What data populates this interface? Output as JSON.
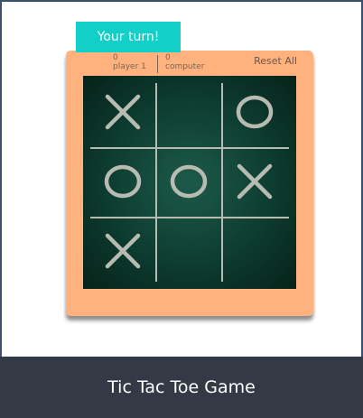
{
  "turn_badge": {
    "text": "Your turn!"
  },
  "scoreboard": {
    "player": {
      "score": "0",
      "label": "player 1"
    },
    "computer": {
      "score": "0",
      "label": "computer"
    }
  },
  "reset_button": {
    "label": "Reset All"
  },
  "board": {
    "cells": [
      "X",
      "",
      "O",
      "O",
      "O",
      "X",
      "X",
      "",
      ""
    ]
  },
  "footer": {
    "title": "Tic Tac Toe Game"
  },
  "colors": {
    "badge": "#12cfc7",
    "card": "#ffb27d",
    "board": "#0d3c30",
    "marks": "#b8bbb2",
    "footer": "#343a45"
  }
}
